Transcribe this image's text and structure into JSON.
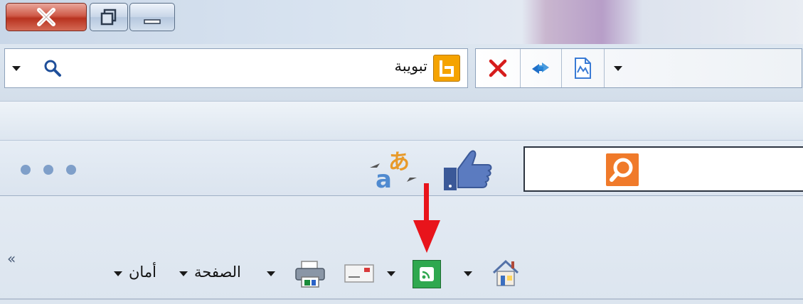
{
  "address_bar": {
    "provider_label": "تبويبة"
  },
  "command_bar": {
    "page_menu_label": "الصفحة",
    "safety_menu_label": "أمان",
    "overflow_label": "«"
  },
  "colors": {
    "close_button": "#c94a36",
    "bing_orange": "#f5a300",
    "feed_green": "#2fa84f",
    "search_orange": "#f07a2a",
    "annotation_arrow": "#e8141b"
  },
  "icons": [
    "close-icon",
    "restore-icon",
    "minimize-icon",
    "search-icon",
    "bing-icon",
    "stop-icon",
    "refresh-icon",
    "compatibility-icon",
    "like-icon",
    "translate-icon",
    "home-icon",
    "feeds-icon",
    "mail-icon",
    "print-icon",
    "more-dots-icon"
  ]
}
